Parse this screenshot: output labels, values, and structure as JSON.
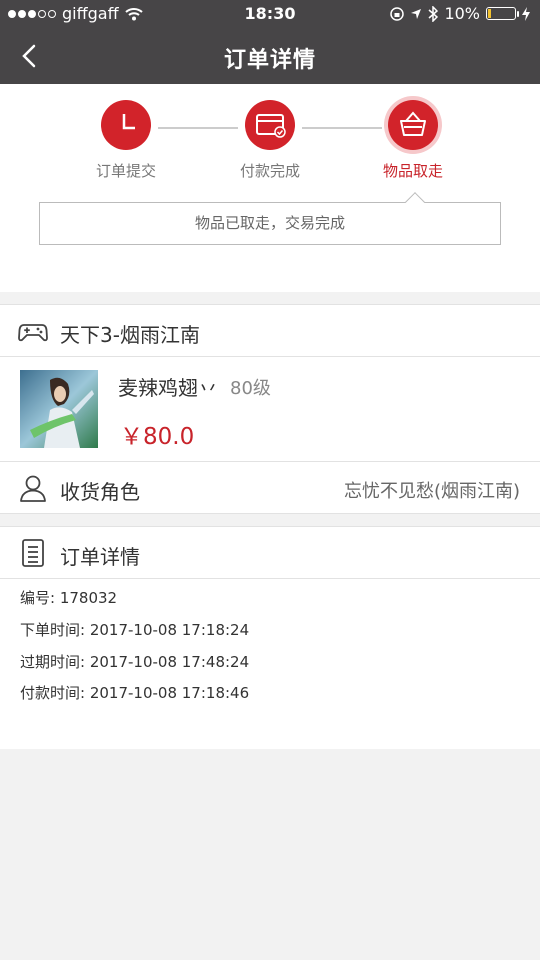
{
  "status_bar": {
    "carrier": "giffgaff",
    "time": "18:30",
    "battery": "10%",
    "battery_level": 0.1
  },
  "nav": {
    "title": "订单详情",
    "back_icon": "chevron-left-icon"
  },
  "progress": {
    "steps": [
      {
        "label": "订单提交",
        "icon": "clock-icon"
      },
      {
        "label": "付款完成",
        "icon": "card-check-icon"
      },
      {
        "label": "物品取走",
        "icon": "basket-icon"
      }
    ],
    "current_step": 3,
    "notice": "物品已取走，交易完成"
  },
  "game": {
    "name": "天下3-烟雨江南",
    "icon": "gamepad-icon"
  },
  "item": {
    "name": "麦辣鸡翅丷",
    "level": "80级",
    "price": "￥80.0"
  },
  "receiver": {
    "label": "收货角色",
    "value": "忘忧不见愁(烟雨江南)",
    "icon": "user-icon"
  },
  "order": {
    "title": "订单详情",
    "icon": "document-icon",
    "lines": [
      "编号: 178032",
      "下单时间: 2017-10-08 17:18:24",
      "过期时间: 2017-10-08 17:48:24",
      "付款时间: 2017-10-08 17:18:46"
    ]
  },
  "colors": {
    "accent": "#d2232a",
    "header": "#474547",
    "background": "#f2f2f2"
  }
}
